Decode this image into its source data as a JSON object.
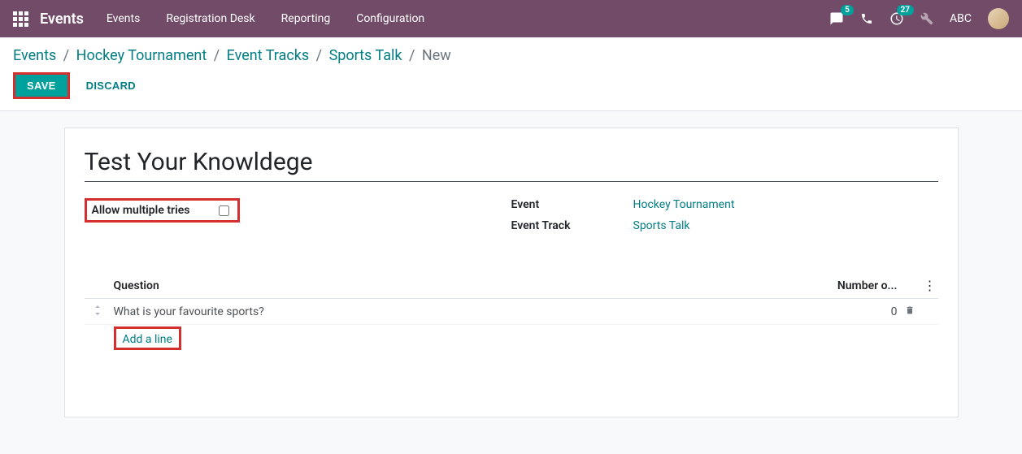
{
  "header": {
    "app_title": "Events",
    "menu": [
      "Events",
      "Registration Desk",
      "Reporting",
      "Configuration"
    ],
    "chat_badge": "5",
    "activities_badge": "27",
    "user": "ABC"
  },
  "breadcrumb": {
    "items": [
      "Events",
      "Hockey Tournament",
      "Event Tracks",
      "Sports Talk"
    ],
    "current": "New"
  },
  "actions": {
    "save": "SAVE",
    "discard": "DISCARD"
  },
  "form": {
    "title": "Test Your Knowldege",
    "allow_tries_label": "Allow multiple tries",
    "allow_tries_checked": false,
    "event_label": "Event",
    "event_value": "Hockey Tournament",
    "track_label": "Event Track",
    "track_value": "Sports Talk"
  },
  "table": {
    "col_question": "Question",
    "col_number": "Number o...",
    "rows": [
      {
        "question": "What is your favourite sports?",
        "number": "0"
      }
    ],
    "add_line": "Add a line"
  }
}
